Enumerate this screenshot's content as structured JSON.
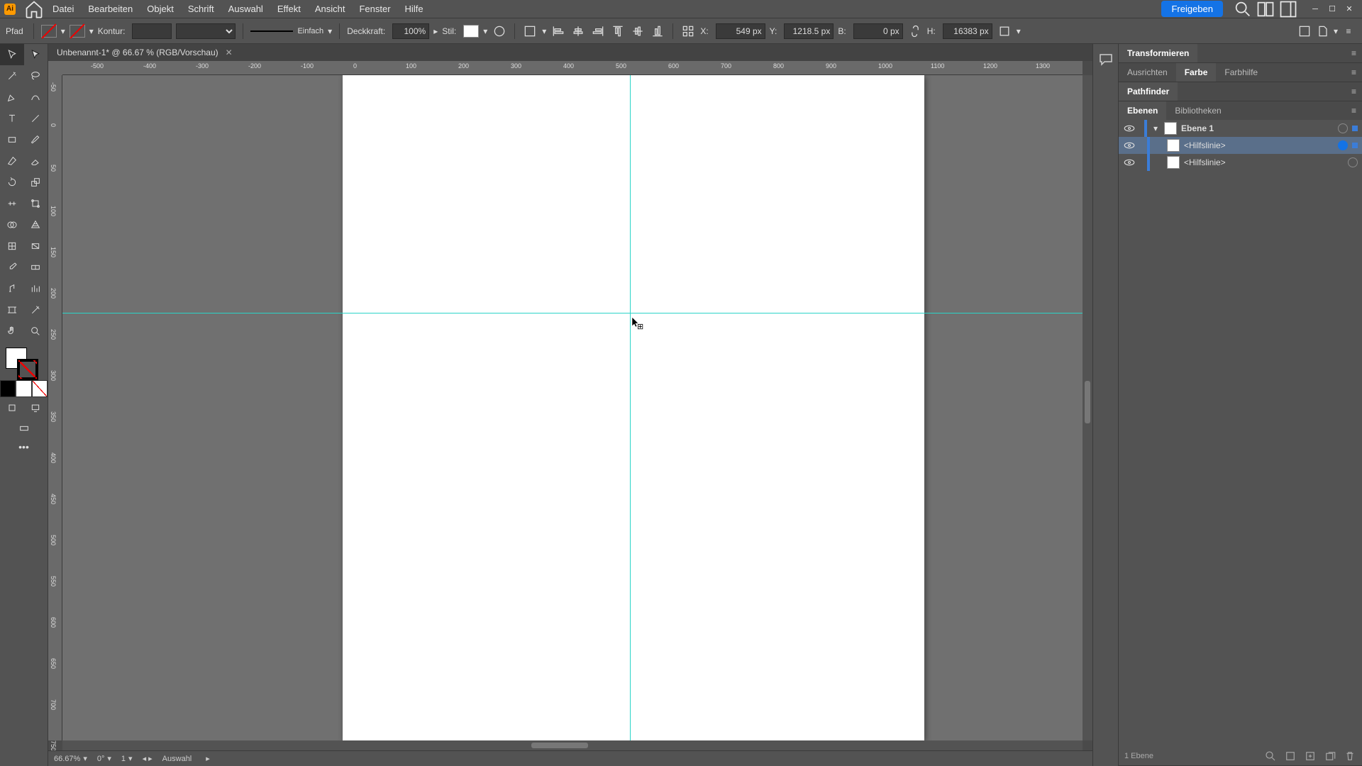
{
  "app": {
    "name": "Ai"
  },
  "menu": {
    "items": [
      "Datei",
      "Bearbeiten",
      "Objekt",
      "Schrift",
      "Auswahl",
      "Effekt",
      "Ansicht",
      "Fenster",
      "Hilfe"
    ]
  },
  "header": {
    "share": "Freigeben"
  },
  "control": {
    "selection_label": "Pfad",
    "stroke_label": "Kontur:",
    "stroke_weight": "",
    "stroke_style": "Einfach",
    "opacity_label": "Deckkraft:",
    "opacity_value": "100%",
    "style_label": "Stil:",
    "x_label": "X:",
    "x_value": "549 px",
    "y_label": "Y:",
    "y_value": "1218.5 px",
    "w_label": "B:",
    "w_value": "0 px",
    "h_label": "H:",
    "h_value": "16383 px"
  },
  "document": {
    "tab_title": "Unbenannt-1* @ 66.67 % (RGB/Vorschau)"
  },
  "ruler": {
    "h": [
      "-500",
      "-400",
      "-300",
      "-200",
      "-100",
      "0",
      "100",
      "200",
      "300",
      "400",
      "500",
      "600",
      "700",
      "800",
      "900",
      "1000",
      "1100",
      "1200",
      "1300"
    ],
    "v": [
      "-50",
      "0",
      "50",
      "100",
      "150",
      "200",
      "250",
      "300",
      "350",
      "400",
      "450",
      "500",
      "550",
      "600",
      "650",
      "700",
      "750"
    ]
  },
  "status": {
    "zoom": "66.67%",
    "rotate": "0°",
    "artboard": "1",
    "tool": "Auswahl"
  },
  "panels": {
    "transform": "Transformieren",
    "tabs_row1": [
      "Ausrichten",
      "Farbe",
      "Farbhilfe"
    ],
    "pathfinder": "Pathfinder",
    "layers_tabs": [
      "Ebenen",
      "Bibliotheken"
    ],
    "layer_name": "Ebene 1",
    "sublayer_name": "<Hilfslinie>",
    "layers_footer": "1 Ebene"
  }
}
